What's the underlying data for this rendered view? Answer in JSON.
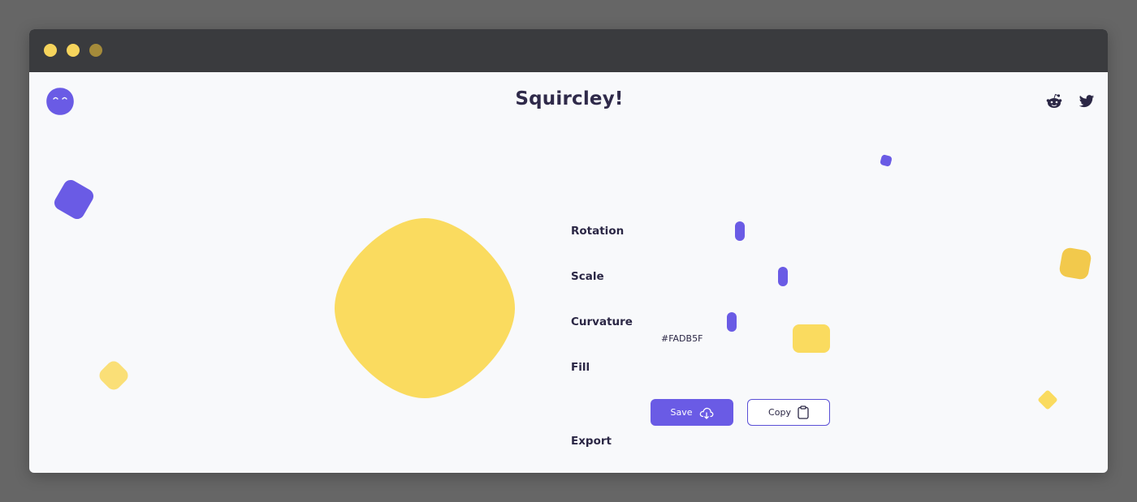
{
  "window": {
    "traffic_lights": [
      "close-dot",
      "minimize-dot",
      "maximize-dot"
    ]
  },
  "header": {
    "title": "Squircley!",
    "logo_icon": "squircle-smile-logo-icon",
    "social_icons": [
      "reddit-icon",
      "twitter-icon"
    ]
  },
  "controls": {
    "rotation": {
      "label": "Rotation"
    },
    "scale": {
      "label": "Scale"
    },
    "curvature": {
      "label": "Curvature"
    },
    "fill": {
      "label": "Fill",
      "value": "#FADB5F"
    },
    "export": {
      "label": "Export",
      "save_label": "Save",
      "copy_label": "Copy",
      "save_icon": "cloud-download-icon",
      "copy_icon": "clipboard-icon"
    }
  },
  "colors": {
    "accent": "#6A5BE5",
    "fill": "#FADB5F",
    "text": "#2B2745",
    "background": "#F8F9FB",
    "titlebar": "#3A3B3E"
  }
}
